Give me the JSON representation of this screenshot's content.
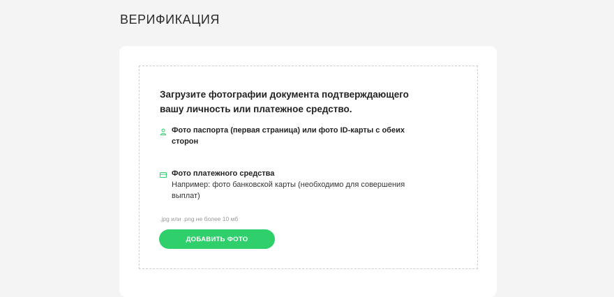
{
  "page": {
    "title": "ВЕРИФИКАЦИЯ"
  },
  "upload": {
    "intro": "Загрузите фотографии документа подтверждающего вашу личность или платежное средство.",
    "requirements": [
      {
        "icon": "person-icon",
        "title": "Фото паспорта (первая страница) или фото ID-карты с обеих сторон",
        "description": ""
      },
      {
        "icon": "card-icon",
        "title": "Фото платежного средства",
        "description": "Например: фото банковской карты (необходимо для совершения выплат)"
      }
    ],
    "file_hint": ".jpg или .png не более 10 мб",
    "add_button_label": "ДОБАВИТЬ ФОТО"
  },
  "colors": {
    "accent": "#2fcf6c",
    "background": "#f4f4f4"
  }
}
